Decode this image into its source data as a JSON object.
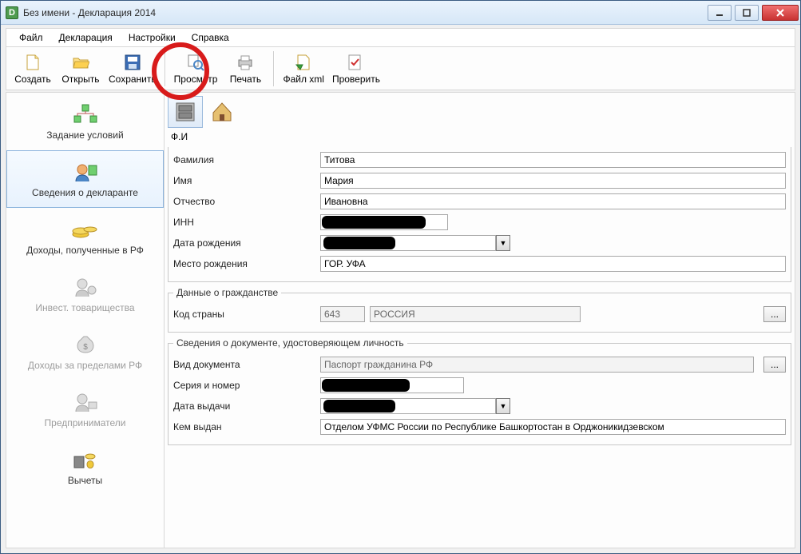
{
  "title": "Без имени - Декларация 2014",
  "menu": {
    "file": "Файл",
    "decl": "Декларация",
    "settings": "Настройки",
    "help": "Справка"
  },
  "toolbar": {
    "create": "Создать",
    "open": "Открыть",
    "save": "Сохранить",
    "view": "Просмотр",
    "print": "Печать",
    "xml": "Файл xml",
    "check": "Проверить"
  },
  "sidebar": {
    "items": [
      {
        "label": "Задание условий",
        "disabled": false
      },
      {
        "label": "Сведения о декларанте",
        "disabled": false
      },
      {
        "label": "Доходы, полученные в РФ",
        "disabled": false
      },
      {
        "label": "Инвест. товарищества",
        "disabled": true
      },
      {
        "label": "Доходы за пределами РФ",
        "disabled": true
      },
      {
        "label": "Предприниматели",
        "disabled": true
      },
      {
        "label": "Вычеты",
        "disabled": false
      }
    ]
  },
  "subtab_label": "Ф.И",
  "fio": {
    "surname_label": "Фамилия",
    "surname": "Титова",
    "name_label": "Имя",
    "name": "Мария",
    "patronymic_label": "Отчество",
    "patronymic": "Ивановна",
    "inn_label": "ИНН",
    "dob_label": "Дата рождения",
    "pob_label": "Место рождения",
    "pob": "ГОР. УФА"
  },
  "citizenship": {
    "legend": "Данные о гражданстве",
    "code_label": "Код страны",
    "code": "643",
    "country": "РОССИЯ"
  },
  "document": {
    "legend": "Сведения о документе, удостоверяющем личность",
    "type_label": "Вид документа",
    "type": "Паспорт гражданина РФ",
    "serial_label": "Серия и номер",
    "date_label": "Дата выдачи",
    "issued_label": "Кем выдан",
    "issued": "Отделом УФМС России по Республике Башкортостан в Орджоникидзевском"
  }
}
